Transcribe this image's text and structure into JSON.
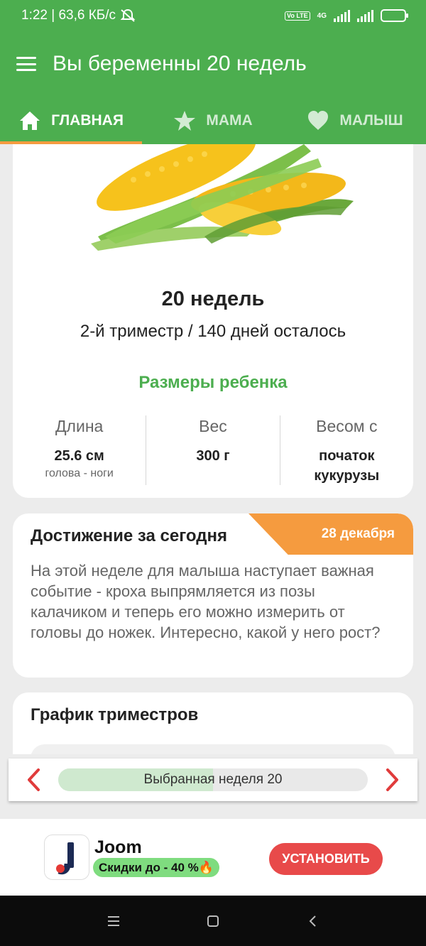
{
  "status_bar": {
    "time_speed": "1:22 | 63,6 КБ/с",
    "network": "4G",
    "lte": "Vo LTE",
    "icons": [
      "mute-icon",
      "signal-icon",
      "battery-icon"
    ]
  },
  "app_bar": {
    "title": "Вы беременны 20 недель",
    "menu_icon": "hamburger-icon"
  },
  "tabs": [
    {
      "label": "ГЛАВНАЯ",
      "icon": "home-icon",
      "active": true
    },
    {
      "label": "МАМА",
      "icon": "star-icon",
      "active": false
    },
    {
      "label": "МАЛЫШ",
      "icon": "heart-icon",
      "active": false
    }
  ],
  "week_card": {
    "image": "corn-icon",
    "title": "20 недель",
    "subtitle": "2-й триместр / 140 дней осталось",
    "sizes_title": "Размеры ребенка",
    "sizes": [
      {
        "label": "Длина",
        "value": "25.6 см",
        "note": "голова - ноги"
      },
      {
        "label": "Вес",
        "value": "300 г",
        "note": ""
      },
      {
        "label": "Весом с",
        "value": "початок кукурузы",
        "note": ""
      }
    ]
  },
  "achievement": {
    "title": "Достижение за сегодня",
    "date": "28 декабря",
    "text": "На этой неделе для малыша наступает важная событие - кроха выпрямляется из позы калачиком и теперь его можно измерить от головы до ножек. Интересно, какой у него рост?"
  },
  "trimester_chart": {
    "title": "График триместров"
  },
  "week_selector": {
    "label": "Выбранная неделя 20",
    "progress": 0.5
  },
  "ad": {
    "app_name": "Joom",
    "promo": "Скидки до -  40  %🔥",
    "install_label": "УСТАНОВИТЬ"
  },
  "colors": {
    "primary": "#4cae4f",
    "accent": "#f59b3f",
    "ad_button": "#e84a4a"
  }
}
